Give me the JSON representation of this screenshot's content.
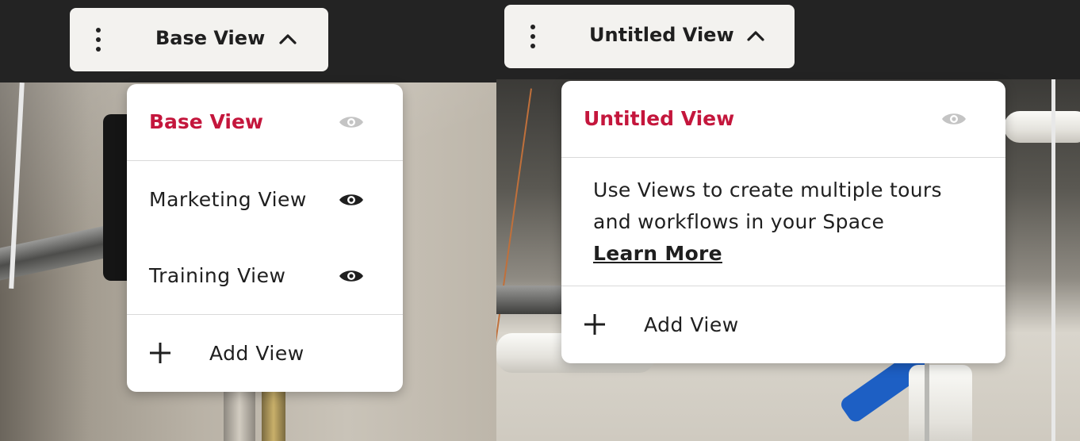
{
  "left": {
    "selector": {
      "title": "Base View"
    },
    "menu": {
      "active_view": "Base View",
      "views": [
        {
          "label": "Marketing View"
        },
        {
          "label": "Training View"
        }
      ],
      "add_view": "Add View"
    }
  },
  "right": {
    "selector": {
      "title": "Untitled View"
    },
    "menu": {
      "active_view": "Untitled View",
      "info_line1": "Use Views to create multiple tours",
      "info_line2": "and workflows in your Space",
      "learn_more": "Learn More",
      "add_view": "Add View"
    }
  },
  "colors": {
    "accent": "#c4163c",
    "eye_active": "#1f1f1f",
    "eye_muted": "#c4c4c4"
  },
  "icons": [
    "kebab-menu-icon",
    "chevron-up-icon",
    "eye-icon",
    "plus-icon"
  ]
}
